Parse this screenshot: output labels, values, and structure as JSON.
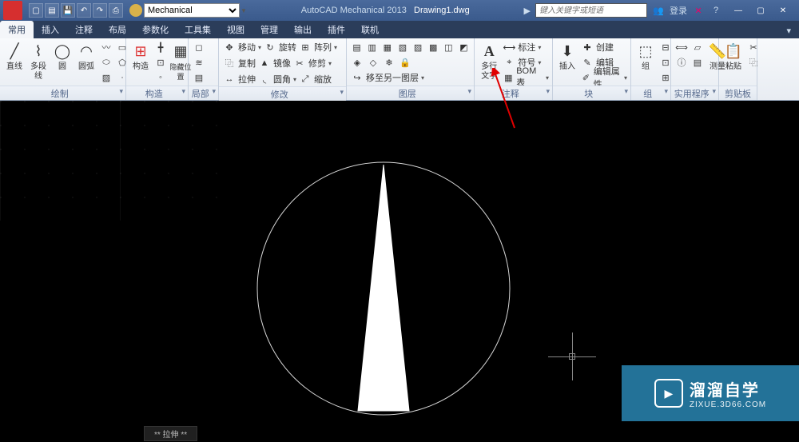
{
  "titlebar": {
    "workspace": "Mechanical",
    "app": "AutoCAD Mechanical 2013",
    "file": "Drawing1.dwg",
    "search_placeholder": "键入关键字或短语",
    "login": "登录",
    "qat": [
      "new",
      "open",
      "save",
      "undo",
      "redo",
      "plot"
    ]
  },
  "tabs": [
    {
      "label": "常用",
      "active": true
    },
    {
      "label": "插入"
    },
    {
      "label": "注释"
    },
    {
      "label": "布局"
    },
    {
      "label": "参数化"
    },
    {
      "label": "工具集"
    },
    {
      "label": "视图"
    },
    {
      "label": "管理"
    },
    {
      "label": "输出"
    },
    {
      "label": "插件"
    },
    {
      "label": "联机"
    }
  ],
  "ribbon": {
    "draw": {
      "title": "绘制",
      "line": "直线",
      "polyline": "多段线",
      "circle": "圆",
      "arc": "圆弧"
    },
    "construct": {
      "title": "构造",
      "main": "构造",
      "hide": "隐藏位置"
    },
    "local": {
      "title": "局部"
    },
    "modify": {
      "title": "修改",
      "move": "移动",
      "copy": "复制",
      "stretch": "拉伸",
      "rotate": "旋转",
      "mirror": "镜像",
      "fillet": "圆角",
      "array": "阵列",
      "trim": "修剪",
      "scale": "缩放"
    },
    "layer": {
      "title": "图层",
      "movetolayer": "移至另一图层"
    },
    "annotate": {
      "title": "注释",
      "mtext": "多行文字",
      "dim": "标注",
      "symbol": "符号",
      "bom": "BOM 表"
    },
    "block": {
      "title": "块",
      "insert": "插入",
      "create": "创建",
      "edit": "编辑",
      "editattr": "编辑属性"
    },
    "group": {
      "title": "组",
      "group": "组"
    },
    "util": {
      "title": "实用程序",
      "measure": "测量"
    },
    "clipboard": {
      "title": "剪贴板",
      "paste": "粘贴"
    }
  },
  "status": {
    "mode": "** 拉伸 **"
  },
  "watermark": {
    "brand": "溜溜自学",
    "url": "ZIXUE.3D66.COM"
  }
}
